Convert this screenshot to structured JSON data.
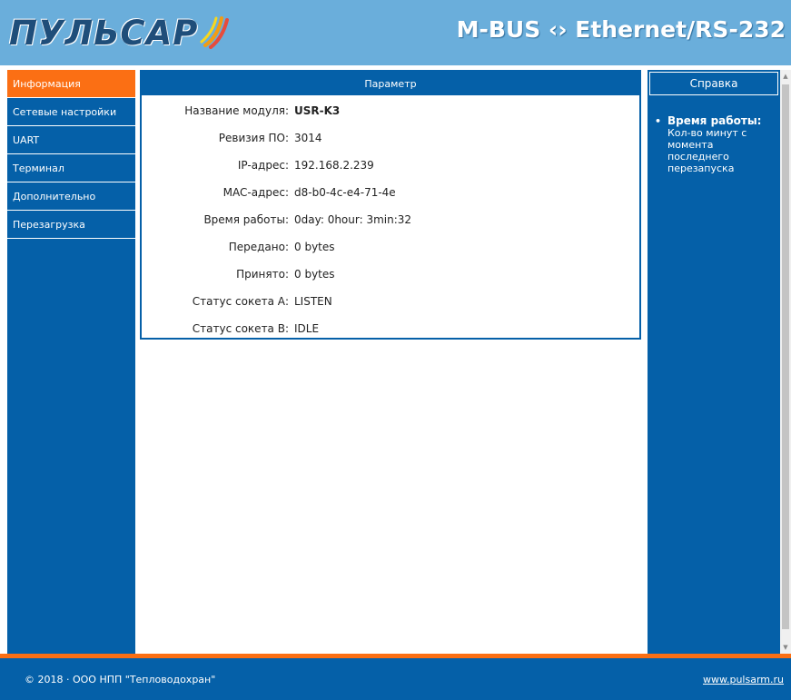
{
  "header": {
    "logo_text": "ПУЛЬСАР",
    "title": "M-BUS ‹› Ethernet/RS-232"
  },
  "sidebar": {
    "items": [
      {
        "label": "Информация",
        "active": true
      },
      {
        "label": "Сетевые настройки"
      },
      {
        "label": "UART"
      },
      {
        "label": "Терминал"
      },
      {
        "label": "Дополнительно"
      },
      {
        "label": "Перезагрузка"
      }
    ]
  },
  "main": {
    "header": "Параметр",
    "rows": [
      {
        "label": "Название модуля:",
        "value": "USR-K3"
      },
      {
        "label": "Ревизия ПО:",
        "value": "3014"
      },
      {
        "label": "IP-адрес:",
        "value": "192.168.2.239"
      },
      {
        "label": "MAC-адрес:",
        "value": "d8-b0-4c-e4-71-4e"
      },
      {
        "label": "Время работы:",
        "value": "0day: 0hour: 3min:32"
      },
      {
        "label": "Передано:",
        "value": "0 bytes"
      },
      {
        "label": "Принято:",
        "value": "0 bytes"
      },
      {
        "label": "Статус сокета А:",
        "value": "LISTEN"
      },
      {
        "label": "Статус сокета В:",
        "value": "IDLE"
      }
    ]
  },
  "help": {
    "header": "Справка",
    "bullet": "•",
    "title": "Время работы:",
    "text": "Кол-во минут с момента последнего перезапуска"
  },
  "footer": {
    "copyright": "© 2018 · ООО НПП \"Тепловодохран\"",
    "link": "www.pulsarm.ru"
  },
  "colors": {
    "header_bg": "#6aaedb",
    "primary_blue": "#0560a8",
    "accent_orange": "#fb6f14"
  },
  "icons": {
    "logo": "swoosh-logo-icon",
    "scroll_up": "scroll-up-arrow-icon",
    "scroll_down": "scroll-down-arrow-icon"
  }
}
